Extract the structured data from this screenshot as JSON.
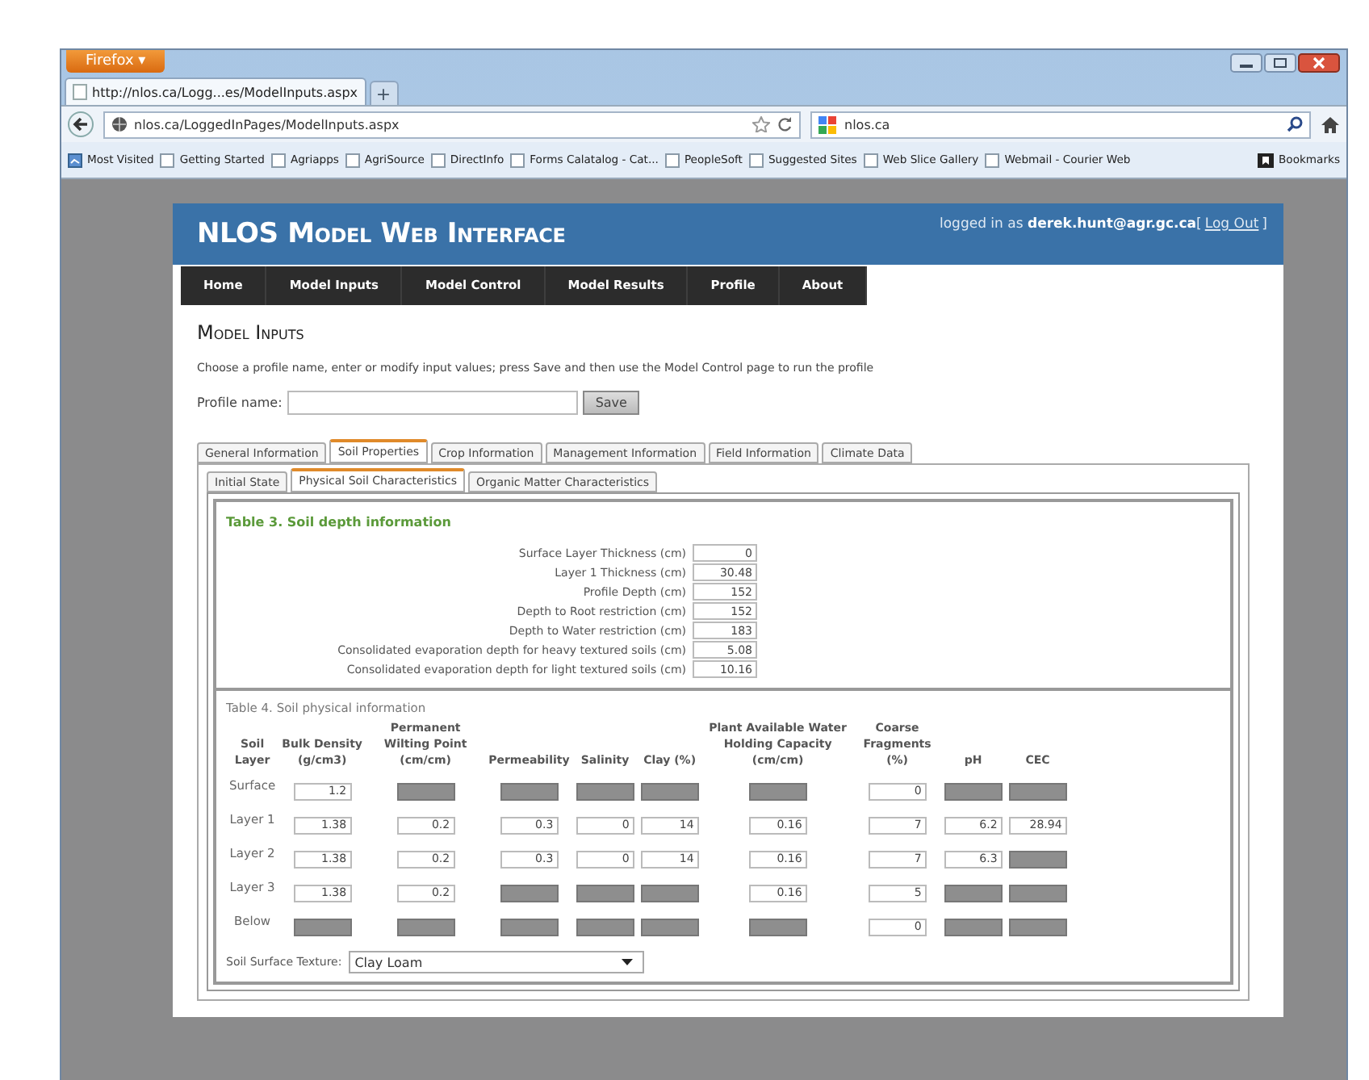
{
  "browser": {
    "app_button": "Firefox ▾",
    "tab": {
      "title": "http://nlos.ca/Logg...es/ModelInputs.aspx",
      "selected": true
    },
    "new_tab": "+",
    "address": "nlos.ca/LoggedInPages/ModelInputs.aspx",
    "search": "nlos.ca",
    "bookmarks": [
      "Most Visited",
      "Getting Started",
      "Agriapps",
      "AgriSource",
      "DirectInfo",
      "Forms Calatalog - Cat...",
      "PeopleSoft",
      "Suggested Sites",
      "Web Slice Gallery",
      "Webmail - Courier Web"
    ],
    "bookmarks_menu": "Bookmarks"
  },
  "site": {
    "title": "NLOS Model Web Interface",
    "login_prefix": "logged in as ",
    "user": "derek.hunt@agr.gc.ca",
    "logout_open": "[",
    "logout": "Log Out",
    "logout_close": "]"
  },
  "nav": [
    "Home",
    "Model Inputs",
    "Model Control",
    "Model Results",
    "Profile",
    "About"
  ],
  "page_title": "Model Inputs",
  "description": "Choose a profile name, enter or modify input values; press Save and then use the Model Control page to run the profile",
  "profile": {
    "label": "Profile name:",
    "save": "Save"
  },
  "tabs": [
    {
      "label": "General Information",
      "selected": false
    },
    {
      "label": "Soil Properties",
      "selected": true
    },
    {
      "label": "Crop Information",
      "selected": false
    },
    {
      "label": "Management Information",
      "selected": false
    },
    {
      "label": "Field Information",
      "selected": false
    },
    {
      "label": "Climate Data",
      "selected": false
    }
  ],
  "subtabs": [
    {
      "label": "Initial State",
      "selected": false
    },
    {
      "label": "Physical Soil Characteristics",
      "selected": true
    },
    {
      "label": "Organic Matter Characteristics",
      "selected": false
    }
  ],
  "table3": {
    "title": "Table 3. Soil depth information",
    "rows": [
      {
        "label": "Surface Layer Thickness (cm)",
        "value": "0"
      },
      {
        "label": "Layer 1 Thickness (cm)",
        "value": "30.48"
      },
      {
        "label": "Profile Depth (cm)",
        "value": "152"
      },
      {
        "label": "Depth to Root restriction (cm)",
        "value": "152"
      },
      {
        "label": "Depth to Water restriction (cm)",
        "value": "183"
      },
      {
        "label": "Consolidated evaporation depth for heavy textured soils (cm)",
        "value": "5.08"
      },
      {
        "label": "Consolidated evaporation depth for light textured soils (cm)",
        "value": "10.16"
      }
    ]
  },
  "table4": {
    "title": "Table 4. Soil physical information",
    "columns": [
      "Soil Layer",
      "Bulk Density (g/cm3)",
      "Permanent Wilting Point (cm/cm)",
      "Permeability",
      "Salinity",
      "Clay (%)",
      "Plant Available Water Holding Capacity (cm/cm)",
      "Coarse Fragments (%)",
      "pH",
      "CEC"
    ],
    "rows": [
      {
        "cells": [
          {
            "kind": "label",
            "text": "Surface"
          },
          {
            "kind": "input",
            "value": "1.2",
            "disabled": false
          },
          {
            "disabled": true
          },
          {
            "disabled": true
          },
          {
            "disabled": true
          },
          {
            "disabled": true
          },
          {
            "disabled": true
          },
          {
            "value": "0",
            "disabled": false
          },
          {
            "disabled": true
          },
          {
            "disabled": true
          }
        ]
      },
      {
        "cells": [
          {
            "kind": "label",
            "text": "Layer 1"
          },
          {
            "kind": "input",
            "value": "1.38",
            "disabled": false
          },
          {
            "value": "0.2",
            "disabled": false
          },
          {
            "value": "0.3",
            "disabled": false
          },
          {
            "value": "0",
            "disabled": false
          },
          {
            "value": "14",
            "disabled": false
          },
          {
            "value": "0.16",
            "disabled": false
          },
          {
            "value": "7",
            "disabled": false
          },
          {
            "value": "6.2",
            "disabled": false
          },
          {
            "value": "28.94",
            "disabled": false
          }
        ]
      },
      {
        "cells": [
          {
            "kind": "label",
            "text": "Layer 2"
          },
          {
            "kind": "input",
            "value": "1.38",
            "disabled": false
          },
          {
            "value": "0.2",
            "disabled": false
          },
          {
            "value": "0.3",
            "disabled": false
          },
          {
            "value": "0",
            "disabled": false
          },
          {
            "value": "14",
            "disabled": false
          },
          {
            "value": "0.16",
            "disabled": false
          },
          {
            "value": "7",
            "disabled": false
          },
          {
            "value": "6.3",
            "disabled": false
          },
          {
            "disabled": true
          }
        ]
      },
      {
        "cells": [
          {
            "kind": "label",
            "text": "Layer 3"
          },
          {
            "kind": "input",
            "value": "1.38",
            "disabled": false
          },
          {
            "value": "0.2",
            "disabled": false
          },
          {
            "disabled": true
          },
          {
            "disabled": true
          },
          {
            "disabled": true
          },
          {
            "value": "0.16",
            "disabled": false
          },
          {
            "value": "5",
            "disabled": false
          },
          {
            "disabled": true
          },
          {
            "disabled": true
          }
        ]
      },
      {
        "cells": [
          {
            "kind": "label",
            "text": "Below"
          },
          {
            "kind": "input",
            "disabled": true
          },
          {
            "disabled": true
          },
          {
            "disabled": true
          },
          {
            "disabled": true
          },
          {
            "disabled": true
          },
          {
            "disabled": true
          },
          {
            "value": "0",
            "disabled": false
          },
          {
            "disabled": true
          },
          {
            "disabled": true
          }
        ]
      }
    ],
    "texture": {
      "label": "Soil Surface Texture:",
      "value": "Clay Loam"
    }
  }
}
